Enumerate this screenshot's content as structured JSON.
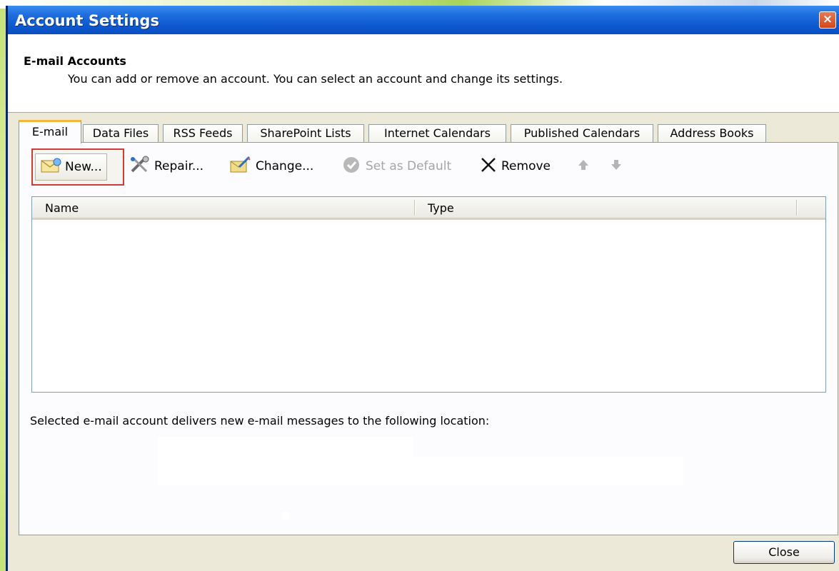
{
  "window": {
    "title": "Account Settings",
    "close_glyph": "×"
  },
  "header": {
    "title": "E-mail Accounts",
    "description": "You can add or remove an account. You can select an account and change its settings."
  },
  "tabs": [
    {
      "label": "E-mail",
      "active": true
    },
    {
      "label": "Data Files",
      "active": false
    },
    {
      "label": "RSS Feeds",
      "active": false
    },
    {
      "label": "SharePoint Lists",
      "active": false
    },
    {
      "label": "Internet Calendars",
      "active": false
    },
    {
      "label": "Published Calendars",
      "active": false
    },
    {
      "label": "Address Books",
      "active": false
    }
  ],
  "toolbar": {
    "new_label": "New...",
    "repair_label": "Repair...",
    "change_label": "Change...",
    "set_default_label": "Set as Default",
    "remove_label": "Remove",
    "icons": {
      "new": "envelope-icon",
      "repair": "tools-icon",
      "change": "edit-icon",
      "set_default": "check-circle-icon",
      "remove": "x-icon",
      "up": "arrow-up-icon",
      "down": "arrow-down-icon"
    }
  },
  "list": {
    "columns": [
      "Name",
      "Type"
    ],
    "rows": []
  },
  "footer": {
    "location_text": "Selected e-mail account delivers new e-mail messages to the following location:",
    "close_label": "Close"
  },
  "colors": {
    "titlebar": "#0d58d0",
    "highlight_box": "#d23b3b",
    "active_tab_accent": "#f7b53a",
    "dialog_bg": "#ece9d8"
  }
}
